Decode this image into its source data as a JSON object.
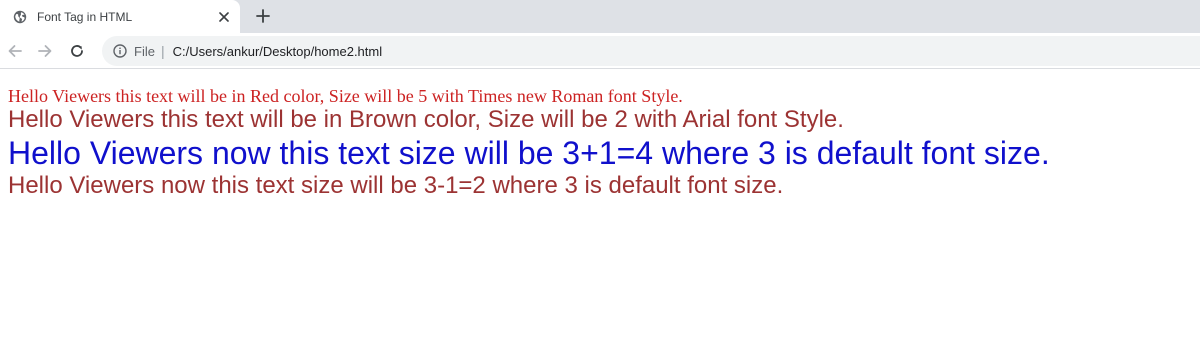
{
  "browser": {
    "tab": {
      "title": "Font Tag in HTML",
      "favicon": "globe-icon",
      "close_icon": "close-icon"
    },
    "new_tab_icon": "plus-icon",
    "toolbar": {
      "back_icon": "back-arrow-icon",
      "forward_icon": "forward-arrow-icon",
      "reload_icon": "reload-icon",
      "info_icon": "info-icon",
      "scheme_label": "File",
      "separator": "|",
      "url": "C:/Users/ankur/Desktop/home2.html"
    }
  },
  "page": {
    "lines": [
      {
        "text": "Hello Viewers this text will be in Red color, Size will be 5 with Times new Roman font Style.",
        "color": "#cc2222"
      },
      {
        "text": "Hello Viewers this text will be in Brown color, Size will be 2 with Arial font Style.",
        "color": "#9c3333"
      },
      {
        "text": "Hello Viewers now this text size will be 3+1=4 where 3 is default font size.",
        "color": "#1010cc"
      },
      {
        "text": "Hello Viewers now this text size will be 3-1=2 where 3 is default font size.",
        "color": "#9c3333"
      }
    ]
  }
}
